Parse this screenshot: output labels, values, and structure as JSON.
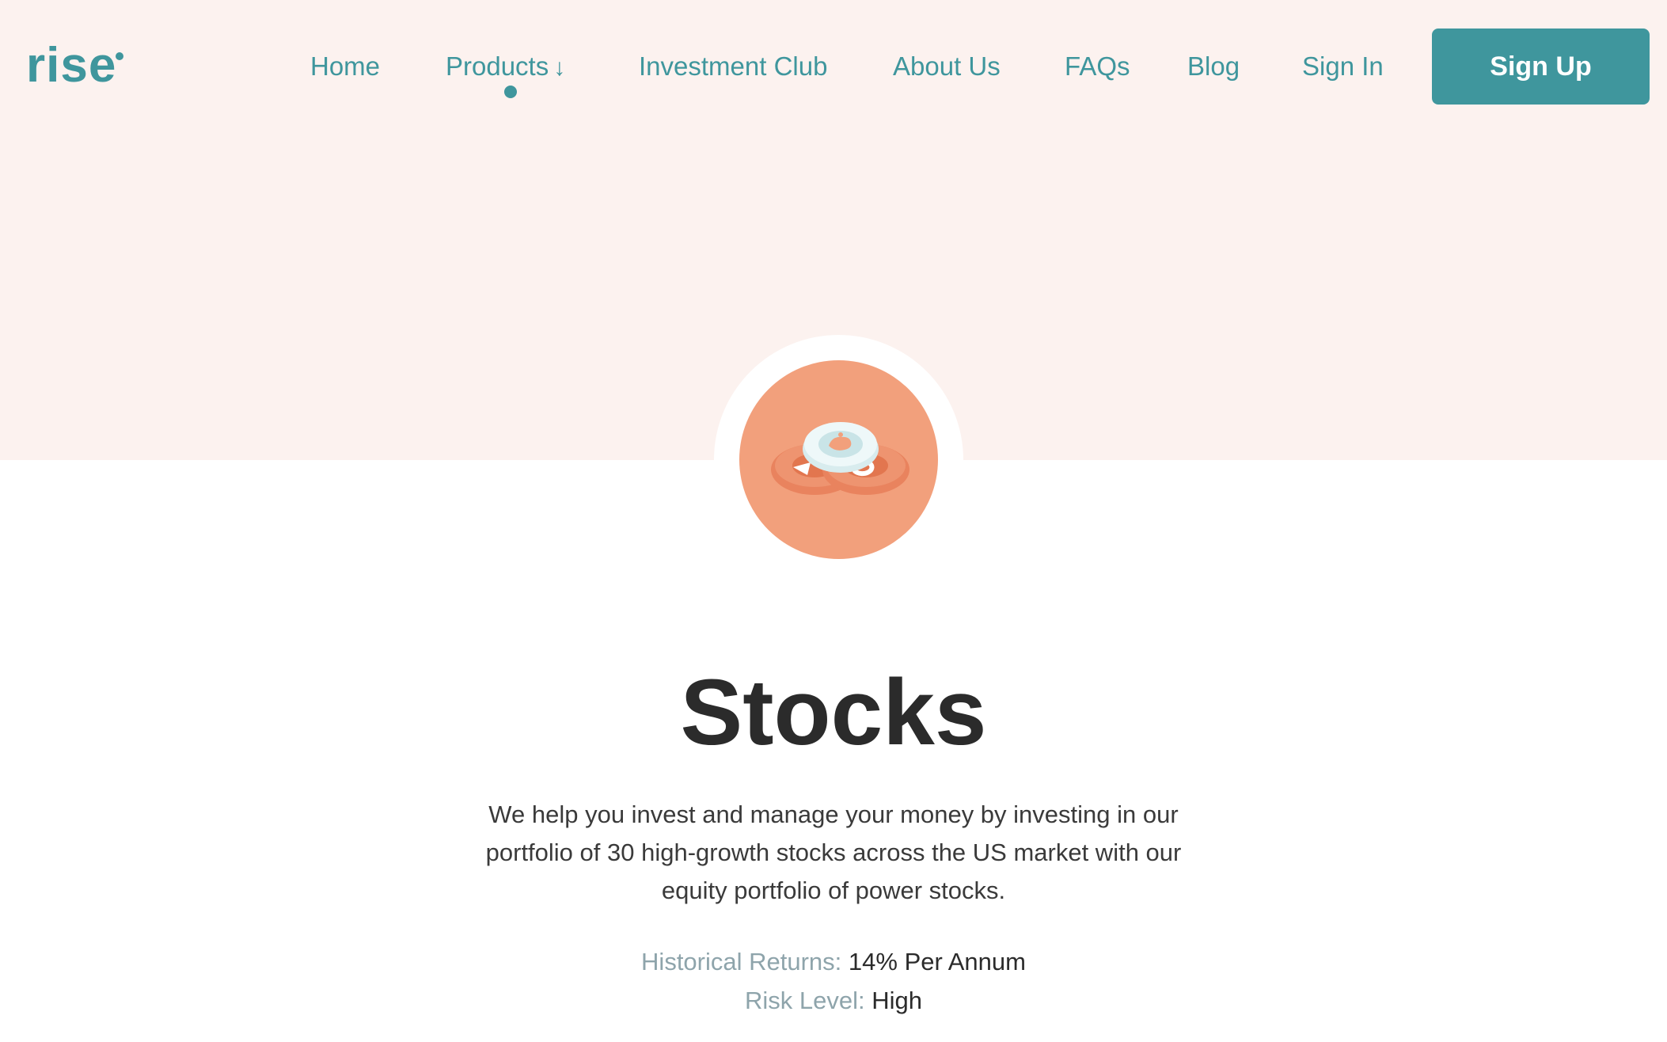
{
  "brand": {
    "logo_text": "rise",
    "accent_color": "#3f969d",
    "hero_bg_color": "#fcf2ef",
    "icon_bg_color": "#f2a07c"
  },
  "nav": {
    "items": [
      {
        "label": "Home"
      },
      {
        "label": "Products"
      },
      {
        "label": "Investment Club"
      },
      {
        "label": "About Us"
      },
      {
        "label": "FAQs"
      },
      {
        "label": "Blog"
      },
      {
        "label": "Sign In"
      }
    ],
    "products_arrow_icon": "arrow-down-icon",
    "active_item": "Products",
    "signup_label": "Sign Up"
  },
  "product": {
    "icon": "coins-icon",
    "title": "Stocks",
    "description": "We help you invest and manage your money by investing in our portfolio of 30 high-growth stocks across the US market with our equity portfolio of power stocks.",
    "returns_label": "Historical Returns:",
    "returns_value": "14% Per Annum",
    "risk_label": "Risk Level:",
    "risk_value": "High"
  }
}
